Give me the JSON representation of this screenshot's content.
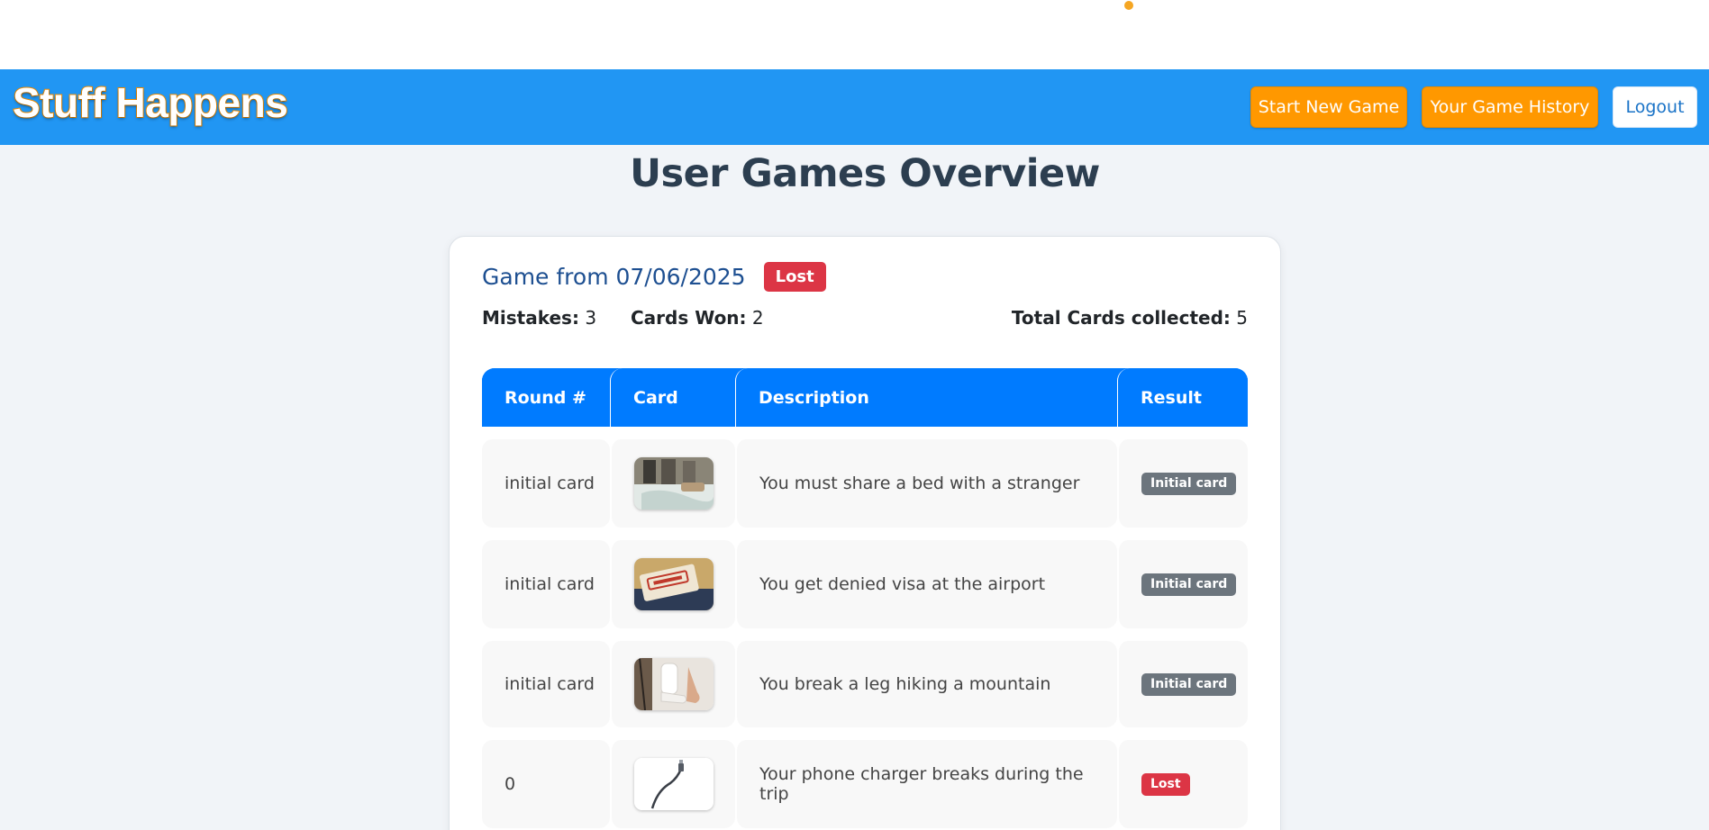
{
  "navbar": {
    "brand": "Stuff Happens",
    "start_new_game": "Start New Game",
    "game_history": "Your Game History",
    "logout": "Logout"
  },
  "page": {
    "title": "User Games Overview"
  },
  "game": {
    "title": "Game from 07/06/2025",
    "status": "Lost",
    "mistakes_label": "Mistakes:",
    "mistakes_value": "3",
    "cards_won_label": "Cards Won:",
    "cards_won_value": "2",
    "total_label": "Total Cards collected:",
    "total_value": "5"
  },
  "table": {
    "headers": [
      "Round #",
      "Card",
      "Description",
      "Result"
    ],
    "rows": [
      {
        "round": "initial card",
        "image": "bed-photo",
        "description": "You must share a bed with a stranger",
        "result": "Initial card"
      },
      {
        "round": "initial card",
        "image": "denied-visa-photo",
        "description": "You get denied visa at the airport",
        "result": "Initial card"
      },
      {
        "round": "initial card",
        "image": "broken-leg-photo",
        "description": "You break a leg hiking a mountain",
        "result": "Initial card"
      },
      {
        "round": "0",
        "image": "phone-charger-photo",
        "description": "Your phone charger breaks during the trip",
        "result": "Lost"
      }
    ]
  },
  "colors": {
    "navbar": "#2196f3",
    "accent_orange": "#ff9800",
    "table_header": "#007bff",
    "lost": "#dc3545",
    "initial": "#6c757d",
    "title": "#2c3e50"
  }
}
